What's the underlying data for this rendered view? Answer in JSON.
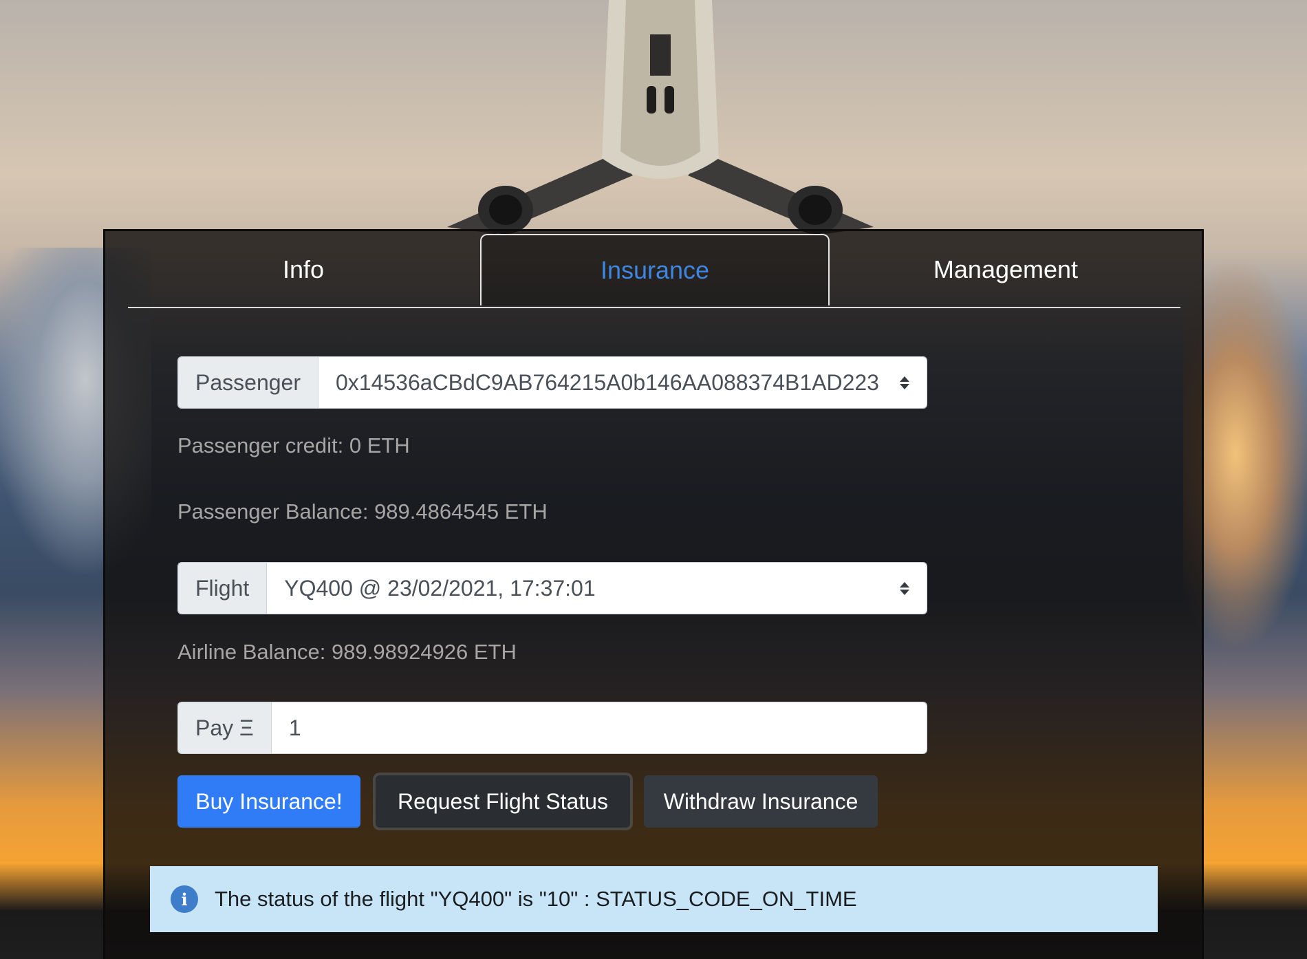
{
  "tabs": [
    {
      "label": "Info"
    },
    {
      "label": "Insurance"
    },
    {
      "label": "Management"
    }
  ],
  "passenger": {
    "label": "Passenger",
    "selected": "0x14536aCBdC9AB764215A0b146AA088374B1AD223"
  },
  "passenger_credit": "Passenger credit: 0 ETH",
  "passenger_balance": "Passenger Balance: 989.4864545 ETH",
  "flight": {
    "label": "Flight",
    "selected": "YQ400 @ 23/02/2021, 17:37:01"
  },
  "airline_balance": "Airline Balance: 989.98924926 ETH",
  "pay": {
    "label": "Pay Ξ",
    "value": "1"
  },
  "buttons": {
    "buy": "Buy Insurance!",
    "request": "Request Flight Status",
    "withdraw": "Withdraw Insurance"
  },
  "alert": {
    "icon": "info-icon",
    "message": "The status of the flight \"YQ400\" is \"10\" : STATUS_CODE_ON_TIME"
  },
  "colors": {
    "primary": "#2f7cf6",
    "active_tab": "#3f86e0",
    "alert_bg": "#c8e4f7"
  }
}
